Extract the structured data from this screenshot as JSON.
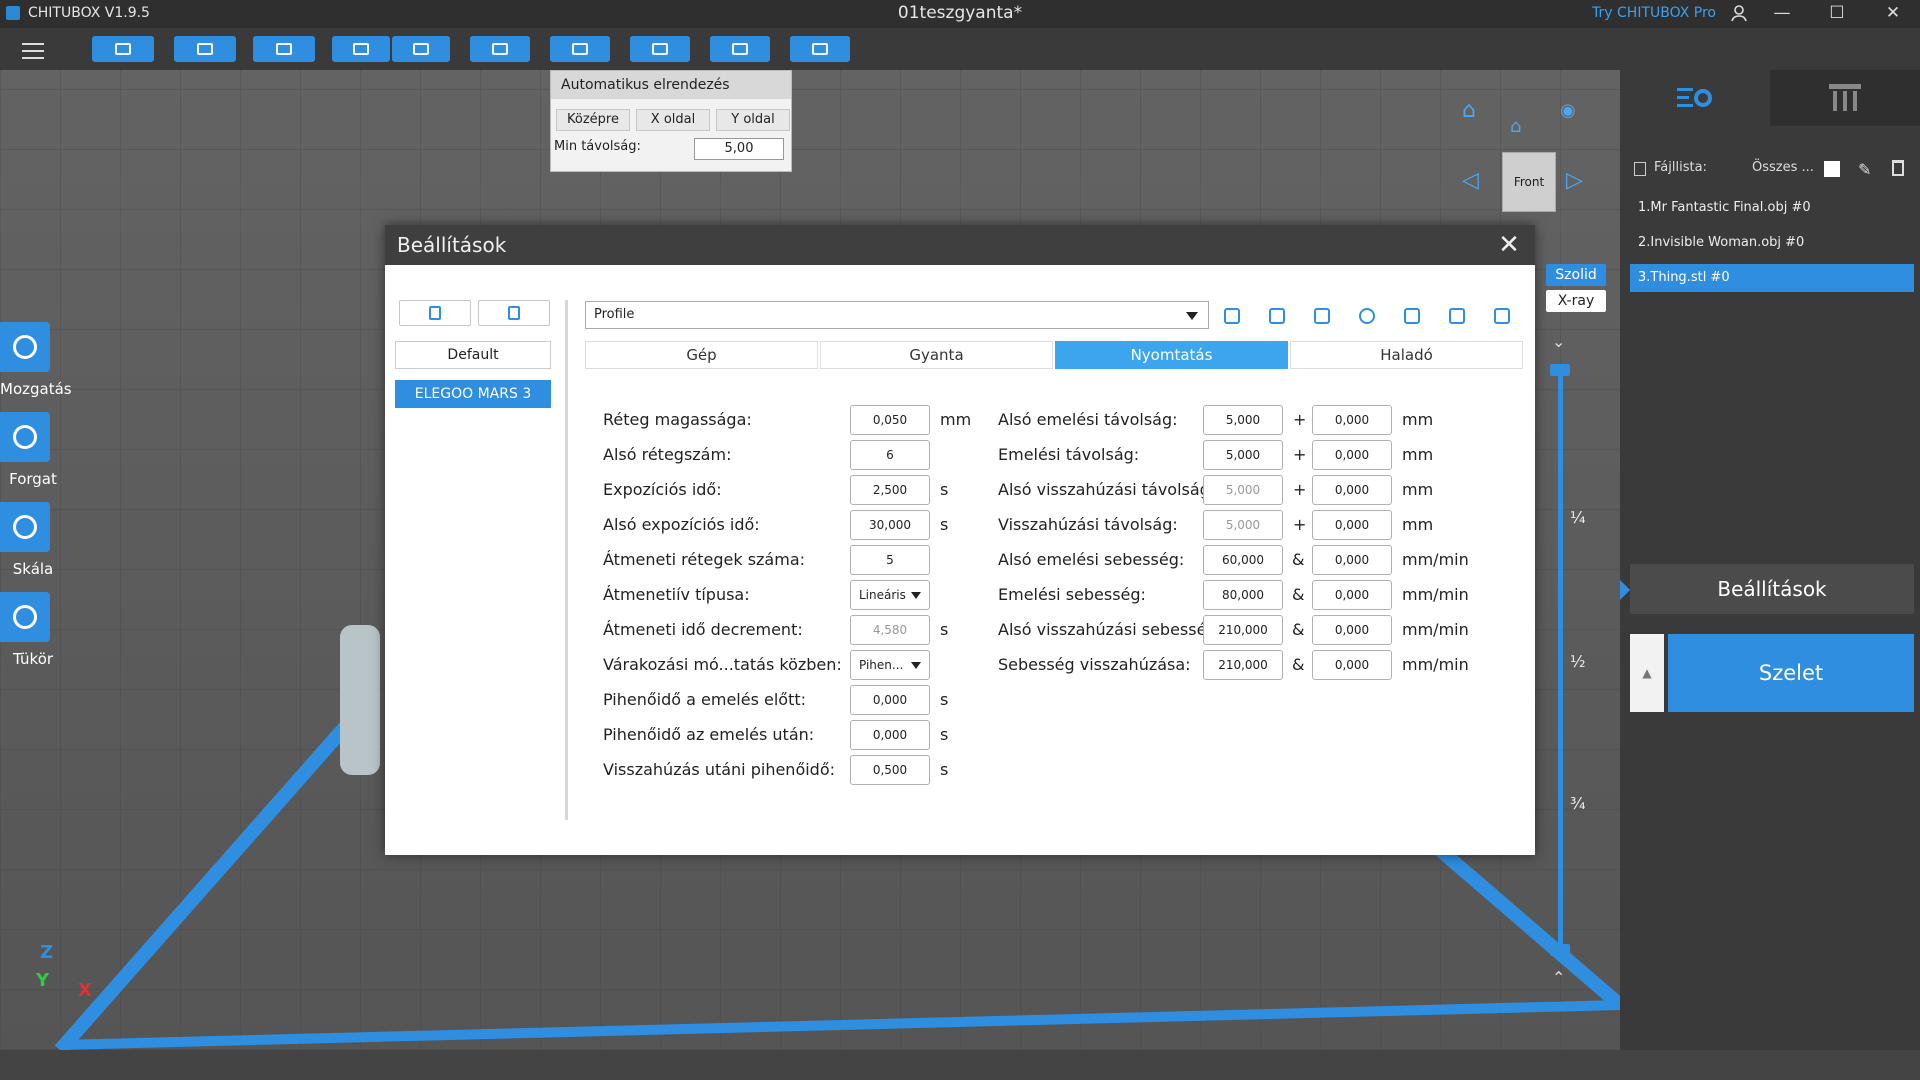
{
  "app": {
    "name": "CHITUBOX V1.9.5",
    "document": "01teszgyanta*",
    "promo": "Try CHITUBOX Pro"
  },
  "window": {
    "minimize": "—",
    "maximize": "☐",
    "close": "✕"
  },
  "auto_arrange": {
    "title": "Automatikus elrendezés",
    "buttons": [
      "Középre",
      "X oldal",
      "Y oldal"
    ],
    "min_distance_label": "Min távolság:",
    "min_distance_value": "5,00"
  },
  "left_tools": [
    "Mozgatás",
    "Forgat",
    "Skála",
    "Tükör"
  ],
  "view": {
    "cube_face": "Front",
    "modes": [
      "Szolid",
      "X-ray"
    ]
  },
  "slider": {
    "marks": [
      "¼",
      "½",
      "¾"
    ]
  },
  "axis": {
    "z": "Z",
    "y": "Y",
    "x": "X"
  },
  "right_panel": {
    "filelist_label": "Fájllista:",
    "select_all": "Összes ...",
    "files": [
      "1.Mr Fantastic Final.obj #0",
      "2.Invisible Woman.obj #0",
      "3.Thing.stl #0"
    ],
    "settings_button": "Beállítások",
    "slice_button": "Szelet",
    "up_arrow": "▲"
  },
  "dialog": {
    "title": "Beállítások",
    "close": "✕",
    "profiles": [
      "Default",
      "ELEGOO MARS 3"
    ],
    "profile_select": "Profile",
    "tabs": [
      "Gép",
      "Gyanta",
      "Nyomtatás",
      "Haladó"
    ],
    "left_params": [
      {
        "label": "Réteg magassága:",
        "value": "0,050",
        "unit": "mm"
      },
      {
        "label": "Alsó rétegszám:",
        "value": "6",
        "unit": ""
      },
      {
        "label": "Expozíciós idő:",
        "value": "2,500",
        "unit": "s"
      },
      {
        "label": "Alsó expozíciós idő:",
        "value": "30,000",
        "unit": "s"
      },
      {
        "label": "Átmeneti rétegek száma:",
        "value": "5",
        "unit": ""
      },
      {
        "label": "Átmenetiív típusa:",
        "value": "Lineáris",
        "unit": ""
      },
      {
        "label": "Átmeneti idő decrement:",
        "value": "4,580",
        "unit": "s"
      },
      {
        "label": "Várakozási mó...tatás közben:",
        "value": "Pihen...",
        "unit": ""
      },
      {
        "label": "Pihenőidő a emelés előtt:",
        "value": "0,000",
        "unit": "s"
      },
      {
        "label": "Pihenőidő az emelés után:",
        "value": "0,000",
        "unit": "s"
      },
      {
        "label": "Visszahúzás utáni pihenőidő:",
        "value": "0,500",
        "unit": "s"
      }
    ],
    "right_params": [
      {
        "label": "Alsó emelési távolság:",
        "value": "5,000",
        "sep": "+",
        "value2": "0,000",
        "unit": "mm"
      },
      {
        "label": "Emelési távolság:",
        "value": "5,000",
        "sep": "+",
        "value2": "0,000",
        "unit": "mm"
      },
      {
        "label": "Alsó visszahúzási távolság:",
        "value": "5,000",
        "sep": "+",
        "value2": "0,000",
        "unit": "mm"
      },
      {
        "label": "Visszahúzási távolság:",
        "value": "5,000",
        "sep": "+",
        "value2": "0,000",
        "unit": "mm"
      },
      {
        "label": "Alsó emelési sebesség:",
        "value": "60,000",
        "sep": "&",
        "value2": "0,000",
        "unit": "mm/min"
      },
      {
        "label": "Emelési sebesség:",
        "value": "80,000",
        "sep": "&",
        "value2": "0,000",
        "unit": "mm/min"
      },
      {
        "label": "Alsó visszahúzási sebesség:",
        "value": "210,000",
        "sep": "&",
        "value2": "0,000",
        "unit": "mm/min"
      },
      {
        "label": "Sebesség visszahúzása:",
        "value": "210,000",
        "sep": "&",
        "value2": "0,000",
        "unit": "mm/min"
      }
    ]
  }
}
